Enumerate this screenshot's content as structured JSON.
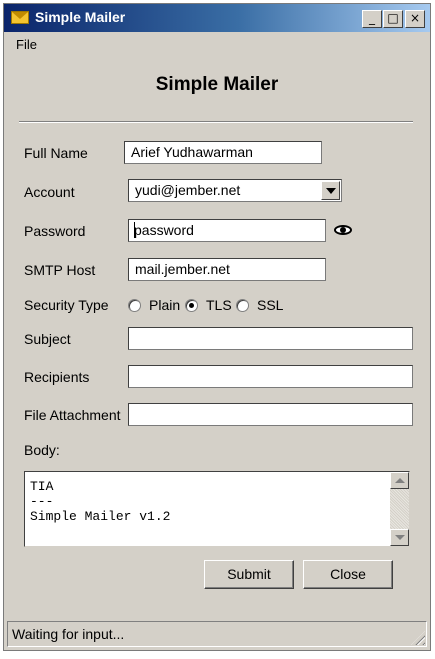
{
  "window": {
    "title": "Simple Mailer",
    "controls": {
      "minimize": "_",
      "maximize": "□",
      "close": "×"
    }
  },
  "menu": {
    "file": "File"
  },
  "heading": "Simple Mailer",
  "form": {
    "full_name": {
      "label": "Full Name",
      "value": "Arief Yudhawarman"
    },
    "account": {
      "label": "Account",
      "value": "yudi@jember.net"
    },
    "password": {
      "label": "Password",
      "value": "password"
    },
    "smtp_host": {
      "label": "SMTP Host",
      "value": "mail.jember.net"
    },
    "security_type": {
      "label": "Security Type",
      "options": [
        "Plain",
        "TLS",
        "SSL"
      ],
      "selected": "TLS"
    },
    "subject": {
      "label": "Subject",
      "value": ""
    },
    "recipients": {
      "label": "Recipients",
      "value": ""
    },
    "file_attachment": {
      "label": "File Attachment",
      "value": ""
    },
    "body": {
      "label": "Body:",
      "lines": [
        "TIA",
        "---",
        "Simple Mailer v1.2"
      ]
    }
  },
  "buttons": {
    "submit": "Submit",
    "close": "Close"
  },
  "status": "Waiting for input...",
  "icons": {
    "app": "envelope-icon",
    "show_password": "eye-icon",
    "dropdown": "chevron-down-icon"
  },
  "colors": {
    "titlebar_start": "#0a246a",
    "titlebar_end": "#a6caf0",
    "window_bg": "#d4d0c8"
  }
}
